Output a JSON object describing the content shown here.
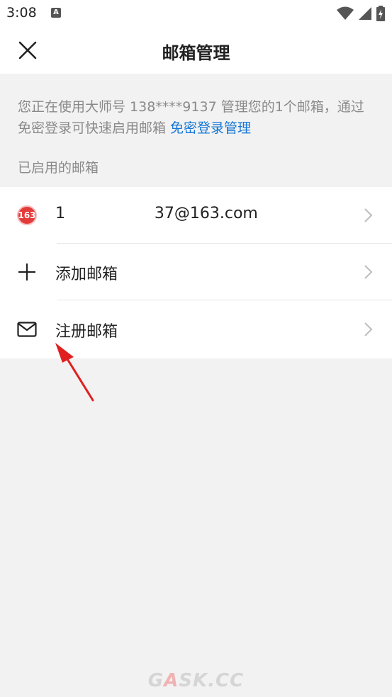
{
  "status_bar": {
    "time": "3:08",
    "notification_icon": "a-icon",
    "icons": [
      "wifi-icon",
      "signal-icon",
      "battery-charging-icon"
    ]
  },
  "header": {
    "title": "邮箱管理",
    "close_icon": "close-icon"
  },
  "description": {
    "text": "您正在使用大师号 138****9137 管理您的1个邮箱，通过免密登录可快速启用邮箱 ",
    "link": "免密登录管理"
  },
  "section": {
    "label": "已启用的邮箱"
  },
  "list": {
    "items": [
      {
        "icon": "163-mail-icon",
        "icon_text": "163",
        "label": "1                  37@163.com"
      },
      {
        "icon": "plus-icon",
        "label": "添加邮箱"
      },
      {
        "icon": "mail-icon",
        "label": "注册邮箱"
      }
    ]
  },
  "watermark": {
    "text_a": "G",
    "text_b": "A",
    "text_c": "SK.CC"
  },
  "colors": {
    "link": "#1677d6",
    "annotation_arrow": "#e02020",
    "badge": "#e33a3a"
  }
}
